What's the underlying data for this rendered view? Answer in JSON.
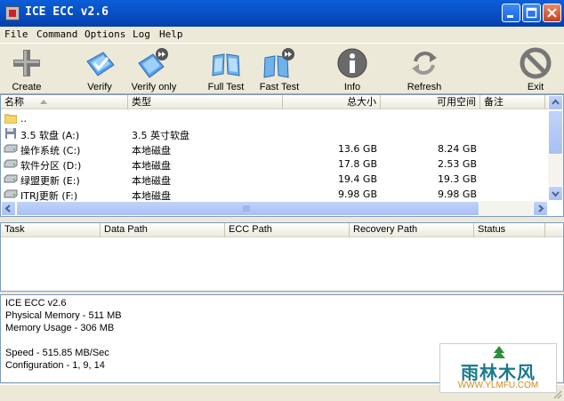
{
  "window": {
    "title": "ICE ECC v2.6"
  },
  "menu": [
    "File",
    "Command",
    "Options",
    "Log",
    "Help"
  ],
  "toolbar": [
    {
      "label": "Create",
      "icon": "plus-icon"
    },
    {
      "label": "Verify",
      "icon": "verify-disk-icon"
    },
    {
      "label": "Verify only",
      "icon": "verify-only-icon"
    },
    {
      "label": "Full Test",
      "icon": "full-test-icon"
    },
    {
      "label": "Fast Test",
      "icon": "fast-test-icon"
    },
    {
      "label": "Info",
      "icon": "info-icon"
    },
    {
      "label": "Refresh",
      "icon": "refresh-icon"
    },
    {
      "label": "Exit",
      "icon": "exit-icon"
    }
  ],
  "drives": {
    "columns": [
      "名称",
      "类型",
      "总大小",
      "可用空间",
      "备注"
    ],
    "rows": [
      {
        "name": "..",
        "type": "",
        "size": "",
        "free": "",
        "icon": "folder-icon"
      },
      {
        "name": "3.5 软盘 (A:)",
        "type": "3.5 英寸软盘",
        "size": "",
        "free": "",
        "icon": "floppy-icon"
      },
      {
        "name": "操作系统 (C:)",
        "type": "本地磁盘",
        "size": "13.6 GB",
        "free": "8.24 GB",
        "icon": "hard-drive-icon"
      },
      {
        "name": "软件分区 (D:)",
        "type": "本地磁盘",
        "size": "17.8 GB",
        "free": "2.53 GB",
        "icon": "hard-drive-icon"
      },
      {
        "name": "绿盟更新 (E:)",
        "type": "本地磁盘",
        "size": "19.4 GB",
        "free": "19.3 GB",
        "icon": "hard-drive-icon"
      },
      {
        "name": "ITRJ更新 (F:)",
        "type": "本地磁盘",
        "size": "9.98 GB",
        "free": "9.98 GB",
        "icon": "hard-drive-icon"
      }
    ]
  },
  "tasks": {
    "columns": [
      "Task",
      "Data Path",
      "ECC Path",
      "Recovery Path",
      "Status"
    ]
  },
  "log": [
    "ICE ECC v2.6",
    "Physical Memory - 511 MB",
    "Memory Usage - 306 MB",
    "",
    "Speed - 515.85 MB/Sec",
    "Configuration - 1, 9, 14"
  ],
  "watermark": {
    "text": "雨林木风",
    "url": "WWW.YLMFU.COM"
  },
  "colors": {
    "titlebar": "#0a5fd8",
    "selection": "#316ac5",
    "chrome": "#ece9d8"
  }
}
